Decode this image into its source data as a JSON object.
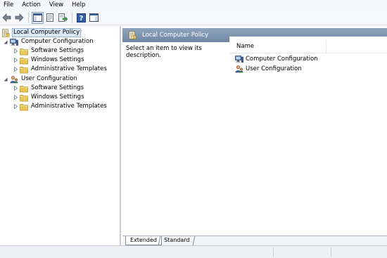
{
  "menu": [
    "File",
    "Action",
    "View",
    "Help"
  ],
  "toolbar": {
    "buttons": [
      "back-arrow-icon",
      "forward-arrow-icon",
      "show-hide-console-tree-icon",
      "properties-icon",
      "export-list-icon",
      "help-icon",
      "show-hide-action-pane-icon"
    ]
  },
  "tree": {
    "root": "Local Computer Policy",
    "computer_configuration": "Computer Configuration",
    "user_configuration": "User Configuration",
    "software_settings": "Software Settings",
    "windows_settings": "Windows Settings",
    "administrative_templates": "Administrative Templates"
  },
  "right_pane": {
    "header_title": "Local Computer Policy",
    "description": "Select an item to view its description.",
    "column_name": "Name",
    "items": [
      "Computer Configuration",
      "User Configuration"
    ]
  },
  "tabs": {
    "extended": "Extended",
    "standard": "Standard"
  },
  "colors": {
    "header_bar": "#7d93ae",
    "folder": "#e8c65a",
    "selection": "#dbe8fa"
  }
}
